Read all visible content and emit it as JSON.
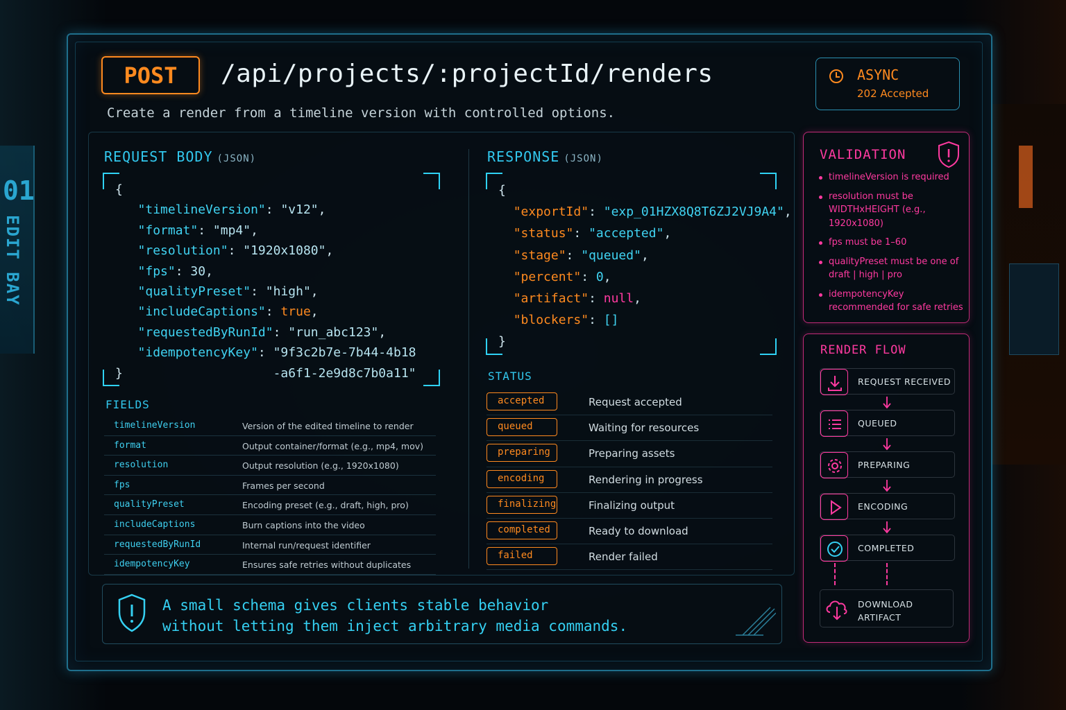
{
  "header": {
    "method": "POST",
    "path": "/api/projects/:projectId/renders",
    "subtitle": "Create a render from a timeline version with controlled options.",
    "async_label": "ASYNC",
    "async_status": "202 Accepted"
  },
  "background": {
    "left_number": "01",
    "left_label": "EDIT BAY"
  },
  "request": {
    "title": "REQUEST BODY",
    "subtitle": "(JSON)",
    "fields": [
      {
        "key": "\"timelineVersion\"",
        "value": "\"v12\""
      },
      {
        "key": "\"format\"",
        "value": "\"mp4\""
      },
      {
        "key": "\"resolution\"",
        "value": "\"1920x1080\""
      },
      {
        "key": "\"fps\"",
        "value": "30"
      },
      {
        "key": "\"qualityPreset\"",
        "value": "\"high\""
      },
      {
        "key": "\"includeCaptions\"",
        "value": "true"
      },
      {
        "key": "\"requestedByRunId\"",
        "value": "\"run_abc123\""
      },
      {
        "key": "\"idempotencyKey\"",
        "value": "\"9f3c2b7e-7b44-4b18"
      }
    ],
    "idempotency_continuation": "-a6f1-2e9d8c7b0a11\""
  },
  "response": {
    "title": "RESPONSE",
    "subtitle": "(JSON)",
    "fields": [
      {
        "key": "\"exportId\"",
        "value": "\"exp_01HZX8Q8T6ZJ2VJ9A4\""
      },
      {
        "key": "\"status\"",
        "value": "\"accepted\""
      },
      {
        "key": "\"stage\"",
        "value": "\"queued\""
      },
      {
        "key": "\"percent\"",
        "value": "0"
      },
      {
        "key": "\"artifact\"",
        "value": "null"
      },
      {
        "key": "\"blockers\"",
        "value": "[]"
      }
    ]
  },
  "fields_table": {
    "title": "FIELDS",
    "rows": [
      {
        "name": "timelineVersion",
        "desc": "Version of the edited timeline to render"
      },
      {
        "name": "format",
        "desc": "Output container/format (e.g., mp4, mov)"
      },
      {
        "name": "resolution",
        "desc": "Output resolution (e.g., 1920x1080)"
      },
      {
        "name": "fps",
        "desc": "Frames per second"
      },
      {
        "name": "qualityPreset",
        "desc": "Encoding preset (e.g., draft, high, pro)"
      },
      {
        "name": "includeCaptions",
        "desc": "Burn captions into the video"
      },
      {
        "name": "requestedByRunId",
        "desc": "Internal run/request identifier"
      },
      {
        "name": "idempotencyKey",
        "desc": "Ensures safe retries without duplicates"
      }
    ]
  },
  "status_table": {
    "title": "STATUS",
    "rows": [
      {
        "badge": "accepted",
        "desc": "Request accepted"
      },
      {
        "badge": "queued",
        "desc": "Waiting for resources"
      },
      {
        "badge": "preparing",
        "desc": "Preparing assets"
      },
      {
        "badge": "encoding",
        "desc": "Rendering in progress"
      },
      {
        "badge": "finalizing",
        "desc": "Finalizing output"
      },
      {
        "badge": "completed",
        "desc": "Ready to download"
      },
      {
        "badge": "failed",
        "desc": "Render failed"
      }
    ]
  },
  "note": {
    "line1": "A small schema gives clients stable behavior",
    "line2": "without letting them inject arbitrary media commands."
  },
  "validation": {
    "title": "VALIDATION",
    "rules": [
      "timelineVersion is required",
      "resolution must be WIDTHxHEIGHT (e.g., 1920x1080)",
      "fps must be 1–60",
      "qualityPreset must be one of draft | high | pro",
      "idempotencyKey recommended for safe retries"
    ]
  },
  "render_flow": {
    "title": "RENDER FLOW",
    "steps": [
      {
        "label": "REQUEST RECEIVED",
        "icon": "download-tray-icon"
      },
      {
        "label": "QUEUED",
        "icon": "list-icon"
      },
      {
        "label": "PREPARING",
        "icon": "gear-icon"
      },
      {
        "label": "ENCODING",
        "icon": "play-icon"
      },
      {
        "label": "COMPLETED",
        "icon": "check-circle-icon"
      }
    ],
    "final_line1": "DOWNLOAD",
    "final_line2": "ARTIFACT",
    "final_icon": "cloud-download-icon"
  },
  "colors": {
    "accent_cyan": "#32c8ee",
    "accent_orange": "#ff8a1f",
    "accent_pink": "#ff3aa0"
  }
}
